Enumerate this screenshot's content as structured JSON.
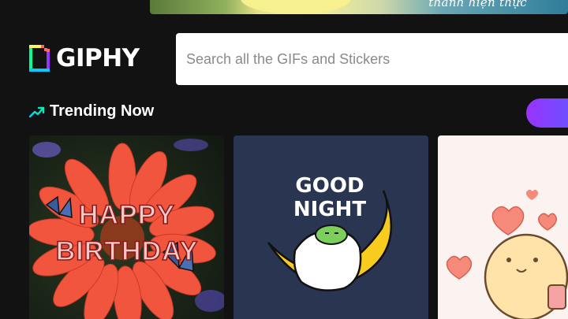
{
  "ad": {
    "text": "thành hiện thực"
  },
  "header": {
    "logo_text": "GIPHY",
    "search_placeholder": "Search all the GIFs and Stickers"
  },
  "trending": {
    "title": "Trending Now"
  },
  "gifs": [
    {
      "caption_line1": "HAPPY",
      "caption_line2": "BIRTHDAY"
    },
    {
      "caption_line1": "GOOD",
      "caption_line2": "NIGHT"
    },
    {
      "caption_line1": "",
      "caption_line2": ""
    }
  ],
  "colors": {
    "background": "#121212",
    "accent_purple": "#9933ff",
    "accent_blue": "#6157ff"
  },
  "icons": {
    "logo": "giphy-logo-icon",
    "trending": "trending-up-icon"
  }
}
